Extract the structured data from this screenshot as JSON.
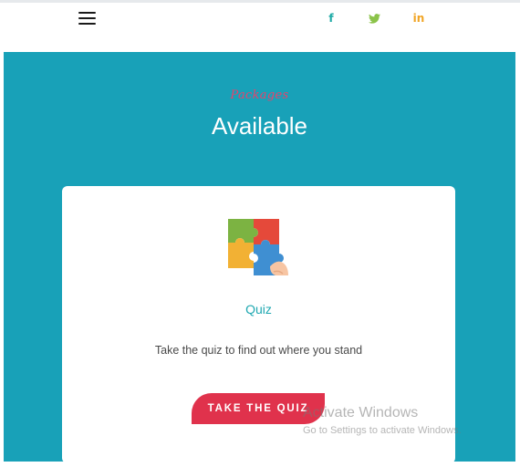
{
  "header": {
    "social": {
      "facebook": {
        "glyph": "f",
        "icon": "facebook-icon",
        "color": "#1eaaa6"
      },
      "twitter": {
        "icon": "twitter-icon",
        "color": "#8bc34a"
      },
      "linkedin": {
        "glyph": "in",
        "icon": "linkedin-icon",
        "color": "#f1a526"
      }
    }
  },
  "hero": {
    "kicker": "Packages",
    "title": "Available",
    "background": "#18a1b8"
  },
  "card": {
    "icon": "puzzle-icon",
    "title": "Quiz",
    "description": "Take the quiz to find out where you stand",
    "button_label": "TAKE THE QUIZ",
    "button_color": "#e0324c"
  },
  "watermark": {
    "title": "Activate Windows",
    "subtitle": "Go to Settings to activate Windows."
  }
}
